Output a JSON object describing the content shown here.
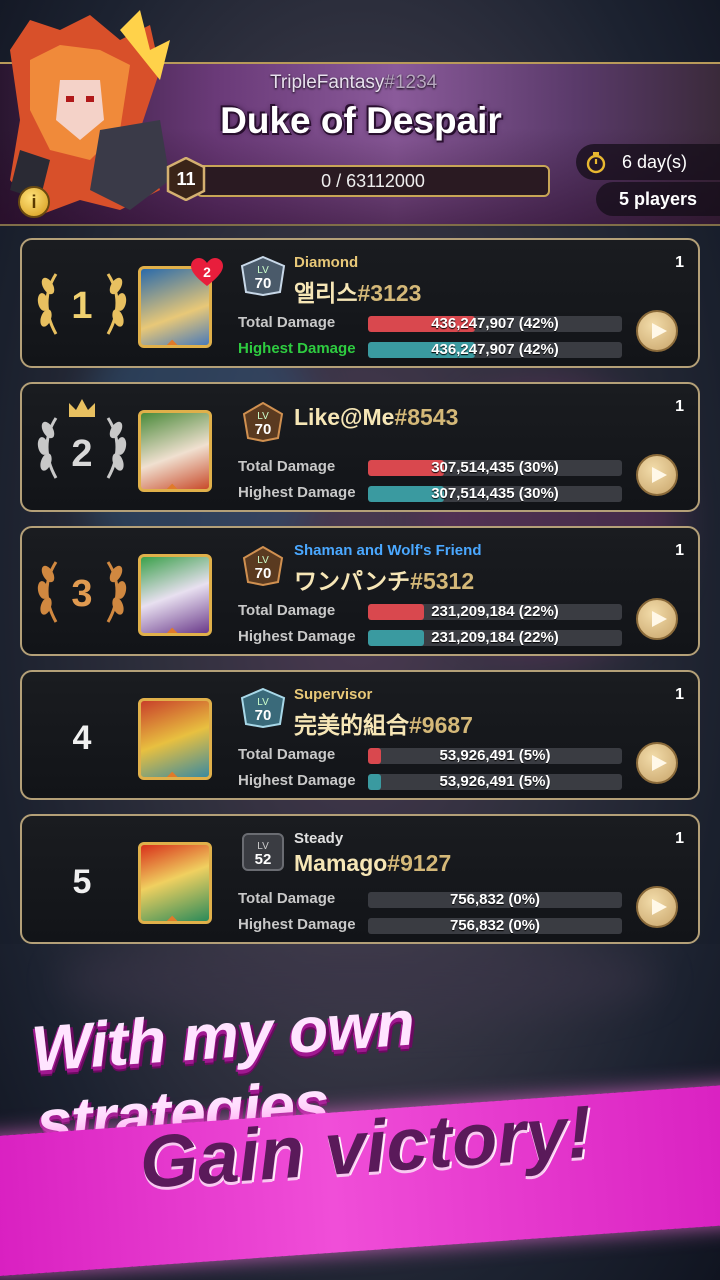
{
  "header": {
    "owner_name": "TripleFantasy",
    "owner_tag": "#1234",
    "boss_name": "Duke of Despair",
    "boss_level": "11",
    "hp_text": "0 / 63112000",
    "timer_text": "6 day(s)",
    "players_text": "5 players",
    "info_icon": "info-icon",
    "timer_icon": "stopwatch-icon"
  },
  "rankings": [
    {
      "rank": "1",
      "title": "Diamond",
      "title_color": "#e8c878",
      "name": "앨리스",
      "tag": "#3123",
      "level": "70",
      "count": "1",
      "hearts": "2",
      "total_label": "Total Damage",
      "highest_label": "Highest Damage",
      "highest_label_color": "#2ecc40",
      "total_text": "436,247,907 (42%)",
      "highest_text": "436,247,907 (42%)",
      "total_pct": 42,
      "highest_pct": 42
    },
    {
      "rank": "2",
      "title": "",
      "title_color": "#e8c878",
      "name": "Like@Me",
      "tag": "#8543",
      "level": "70",
      "count": "1",
      "total_label": "Total Damage",
      "highest_label": "Highest Damage",
      "highest_label_color": "#c8c8c8",
      "total_text": "307,514,435 (30%)",
      "highest_text": "307,514,435 (30%)",
      "total_pct": 30,
      "highest_pct": 30
    },
    {
      "rank": "3",
      "title": "Shaman and Wolf's Friend",
      "title_color": "#4aa8ff",
      "name": "ワンパンチ",
      "tag": "#5312",
      "level": "70",
      "count": "1",
      "total_label": "Total Damage",
      "highest_label": "Highest Damage",
      "highest_label_color": "#c8c8c8",
      "total_text": "231,209,184 (22%)",
      "highest_text": "231,209,184 (22%)",
      "total_pct": 22,
      "highest_pct": 22
    },
    {
      "rank": "4",
      "title": "Supervisor",
      "title_color": "#e8c878",
      "name": "完美的組合",
      "tag": "#9687",
      "level": "70",
      "count": "1",
      "total_label": "Total Damage",
      "highest_label": "Highest Damage",
      "highest_label_color": "#c8c8c8",
      "total_text": "53,926,491 (5%)",
      "highest_text": "53,926,491 (5%)",
      "total_pct": 5,
      "highest_pct": 5
    },
    {
      "rank": "5",
      "title": "Steady",
      "title_color": "#e0e0e0",
      "name": "Mamago",
      "tag": "#9127",
      "level": "52",
      "count": "1",
      "total_label": "Total Damage",
      "highest_label": "Highest Damage",
      "highest_label_color": "#c8c8c8",
      "total_text": "756,832 (0%)",
      "highest_text": "756,832 (0%)",
      "total_pct": 0,
      "highest_pct": 0
    }
  ],
  "level_prefix": "LV",
  "colors": {
    "total_bar": "#d9484e",
    "highest_bar": "#3a9aa0",
    "gold": "#e8c060",
    "silver": "#c8c8c8",
    "bronze": "#d08840"
  },
  "promo": {
    "line1": "With my own strategies",
    "line2": "Gain victory!"
  }
}
